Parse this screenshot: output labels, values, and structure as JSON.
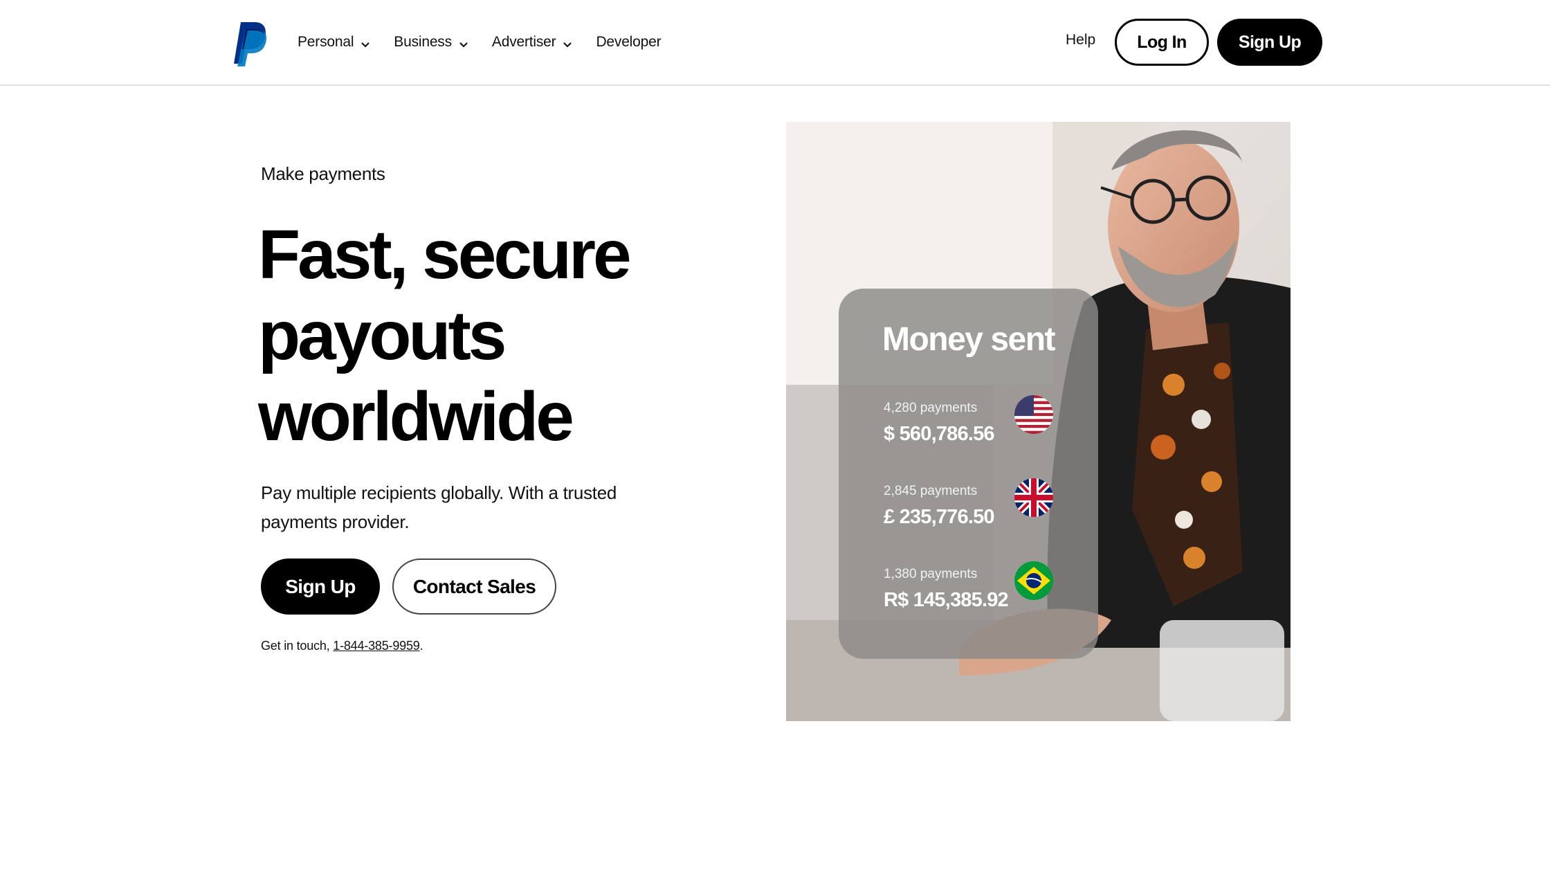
{
  "header": {
    "nav": [
      {
        "label": "Personal",
        "has_dropdown": true
      },
      {
        "label": "Business",
        "has_dropdown": true
      },
      {
        "label": "Advertiser",
        "has_dropdown": true
      },
      {
        "label": "Developer",
        "has_dropdown": false
      }
    ],
    "help_label": "Help",
    "login_label": "Log In",
    "signup_label": "Sign Up"
  },
  "hero": {
    "eyebrow": "Make payments",
    "headline_lines": [
      "Fast, secure",
      "payouts",
      "worldwide"
    ],
    "subtext": "Pay multiple recipients globally. With a trusted payments provider.",
    "primary_cta": "Sign Up",
    "secondary_cta": "Contact Sales",
    "contact_prefix": "Get in touch, ",
    "contact_phone": "1-844-385-9959",
    "contact_suffix": "."
  },
  "card": {
    "title": "Money sent",
    "rows": [
      {
        "count": "4,280 payments",
        "amount": "$ 560,786.56",
        "flag": "us-flag-icon"
      },
      {
        "count": "2,845 payments",
        "amount": "£ 235,776.50",
        "flag": "uk-flag-icon"
      },
      {
        "count": "1,380 payments",
        "amount": "R$ 145,385.92",
        "flag": "brazil-flag-icon"
      }
    ]
  },
  "colors": {
    "primary": "#000000",
    "background": "#ffffff",
    "logo_dark": "#003087",
    "logo_light": "#0079c1",
    "card_bg": "#8c8a87"
  }
}
